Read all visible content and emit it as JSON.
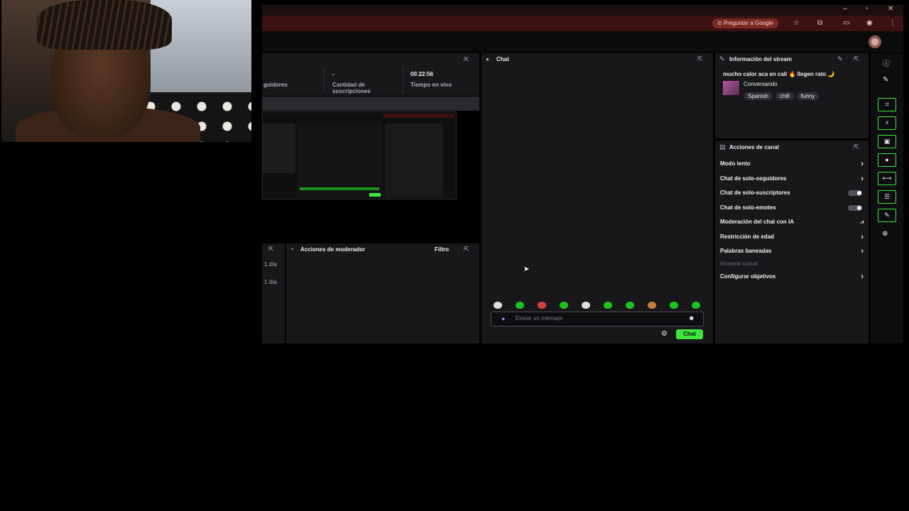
{
  "browser": {
    "ask_google": "Preguntar a Google",
    "window_controls": [
      "minimize-icon",
      "restore-icon",
      "close-icon"
    ]
  },
  "stats": {
    "followers_label": "guidores",
    "subs_value": "-",
    "subs_label": "Cantidad de suscripciones",
    "live_time": "00:22:56",
    "live_label": "Tiempo en vivo"
  },
  "mod_actions": {
    "title": "Acciones de moderador",
    "filter": "Filtro",
    "entries": [
      "1 día",
      "1 día"
    ]
  },
  "chat": {
    "title": "Chat",
    "placeholder": "Enviar un mensaje",
    "send_label": "Chat"
  },
  "stream_info": {
    "title": "Información del stream",
    "stream_title": "mucho calor aca en cali 🔥 llegen rato 🌙",
    "category": "Conversando",
    "tags": [
      "Spanish",
      "chill",
      "funny"
    ]
  },
  "channel_actions": {
    "title": "Acciones de canal",
    "items": [
      {
        "label": "Modo lento",
        "control": "arrow"
      },
      {
        "label": "Chat de solo-seguidores",
        "control": "arrow"
      },
      {
        "label": "Chat de solo-suscriptores",
        "control": "toggle"
      },
      {
        "label": "Chat de solo-emotes",
        "control": "toggle"
      },
      {
        "label": "Moderación del chat con IA",
        "control": "chart"
      },
      {
        "label": "Restricción de edad",
        "control": "arrow"
      },
      {
        "label": "Palabras baneadas",
        "control": "arrow"
      },
      {
        "label": "Hostear canal",
        "control": "disabled"
      },
      {
        "label": "Configurar objetivos",
        "control": "arrow"
      }
    ]
  },
  "colors": {
    "accent_green": "#3ee63e",
    "panel_bg": "#18181b",
    "browser_bar": "#3b1111"
  }
}
